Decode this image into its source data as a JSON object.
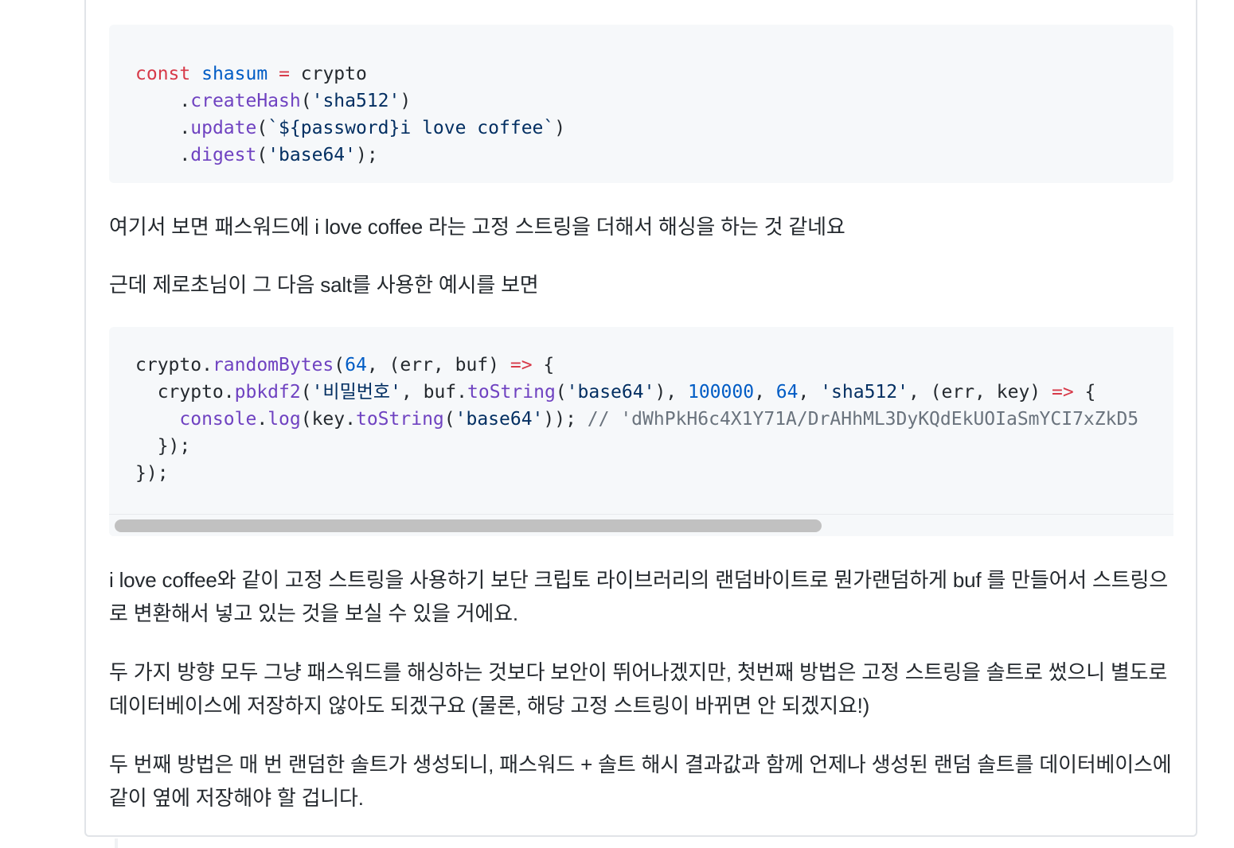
{
  "code_blocks": [
    {
      "lines": [
        [
          {
            "t": "const",
            "c": "kw"
          },
          {
            "t": " "
          },
          {
            "t": "shasum",
            "c": "nm"
          },
          {
            "t": " "
          },
          {
            "t": "=",
            "c": "kw"
          },
          {
            "t": " crypto"
          }
        ],
        [
          {
            "t": "    ."
          },
          {
            "t": "createHash",
            "c": "fn"
          },
          {
            "t": "("
          },
          {
            "t": "'sha512'",
            "c": "st"
          },
          {
            "t": ")"
          }
        ],
        [
          {
            "t": "    ."
          },
          {
            "t": "update",
            "c": "fn"
          },
          {
            "t": "("
          },
          {
            "t": "`${password}i love coffee`",
            "c": "st"
          },
          {
            "t": ")"
          }
        ],
        [
          {
            "t": "    ."
          },
          {
            "t": "digest",
            "c": "fn"
          },
          {
            "t": "("
          },
          {
            "t": "'base64'",
            "c": "st"
          },
          {
            "t": ");"
          }
        ]
      ]
    },
    {
      "lines": [
        [
          {
            "t": "crypto."
          },
          {
            "t": "randomBytes",
            "c": "fn"
          },
          {
            "t": "("
          },
          {
            "t": "64",
            "c": "nm"
          },
          {
            "t": ", (err, buf) "
          },
          {
            "t": "=>",
            "c": "kw"
          },
          {
            "t": " {"
          }
        ],
        [
          {
            "t": "  crypto."
          },
          {
            "t": "pbkdf2",
            "c": "fn"
          },
          {
            "t": "("
          },
          {
            "t": "'비밀번호'",
            "c": "st"
          },
          {
            "t": ", buf."
          },
          {
            "t": "toString",
            "c": "fn"
          },
          {
            "t": "("
          },
          {
            "t": "'base64'",
            "c": "st"
          },
          {
            "t": "), "
          },
          {
            "t": "100000",
            "c": "nm"
          },
          {
            "t": ", "
          },
          {
            "t": "64",
            "c": "nm"
          },
          {
            "t": ", "
          },
          {
            "t": "'sha512'",
            "c": "st"
          },
          {
            "t": ", (err, key) "
          },
          {
            "t": "=>",
            "c": "kw"
          },
          {
            "t": " {"
          }
        ],
        [
          {
            "t": "    "
          },
          {
            "t": "console",
            "c": "fn"
          },
          {
            "t": "."
          },
          {
            "t": "log",
            "c": "fn"
          },
          {
            "t": "(key."
          },
          {
            "t": "toString",
            "c": "fn"
          },
          {
            "t": "("
          },
          {
            "t": "'base64'",
            "c": "st"
          },
          {
            "t": ")); "
          },
          {
            "t": "// 'dWhPkH6c4X1Y71A/DrAHhML3DyKQdEkUOIaSmYCI7xZkD5",
            "c": "cm"
          }
        ],
        [
          {
            "t": "  });"
          }
        ],
        [
          {
            "t": "});"
          }
        ]
      ]
    }
  ],
  "paragraphs": {
    "p1": "여기서 보면 패스워드에 i love coffee 라는 고정 스트링을 더해서 해싱을 하는 것 같네요",
    "p2": "근데 제로초님이 그 다음 salt를 사용한 예시를 보면",
    "p3": "i love coffee와 같이 고정 스트링을 사용하기 보단 크립토 라이브러리의 랜덤바이트로 뭔가랜덤하게 buf 를 만들어서 스트링으로 변환해서 넣고 있는 것을 보실 수 있을 거에요.",
    "p4": "두 가지 방향 모두 그냥 패스워드를 해싱하는 것보다 보안이 뛰어나겠지만, 첫번째 방법은 고정 스트링을 솔트로 썼으니 별도로 데이터베이스에 저장하지 않아도 되겠구요 (물론, 해당 고정 스트링이 바뀌면 안 되겠지요!)",
    "p5": "두 번째 방법은 매 번 랜덤한 솔트가 생성되니, 패스워드 + 솔트 해시 결과값과 함께 언제나 생성된 랜덤 솔트를 데이터베이스에 같이 옆에 저장해야 할 겁니다."
  }
}
